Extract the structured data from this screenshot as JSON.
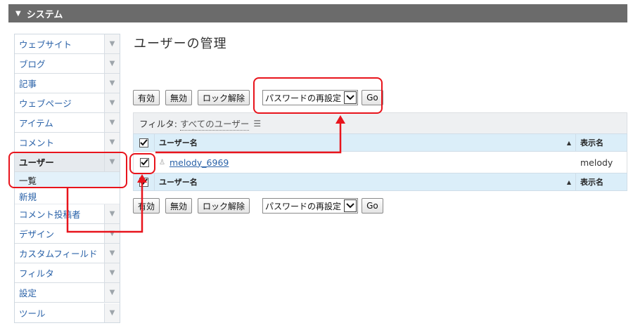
{
  "topbar": {
    "title": "システム"
  },
  "sidebar": {
    "items": [
      {
        "label": "ウェブサイト"
      },
      {
        "label": "ブログ"
      },
      {
        "label": "記事"
      },
      {
        "label": "ウェブページ"
      },
      {
        "label": "アイテム"
      },
      {
        "label": "コメント"
      }
    ],
    "active": {
      "label": "ユーザー",
      "subitems": [
        {
          "label": "一覧"
        },
        {
          "label": "新規"
        }
      ]
    },
    "items_after": [
      {
        "label": "コメント投稿者"
      },
      {
        "label": "デザイン"
      },
      {
        "label": "カスタムフィールド"
      },
      {
        "label": "フィルタ"
      },
      {
        "label": "設定"
      },
      {
        "label": "ツール"
      }
    ]
  },
  "main": {
    "title": "ユーザーの管理",
    "actions": {
      "enable": "有効",
      "disable": "無効",
      "unlock": "ロック解除",
      "select_value": "パスワードの再設定",
      "go": "Go"
    },
    "filter": {
      "label": "フィルタ:",
      "value": "すべてのユーザー"
    },
    "table": {
      "col_username": "ユーザー名",
      "col_display": "表示名",
      "rows": [
        {
          "username": "melody_6969",
          "display": "melody",
          "checked": true
        }
      ]
    }
  },
  "colors": {
    "highlight": "#e8141c",
    "link": "#2a62a8",
    "header_bg": "#dbeef9"
  }
}
